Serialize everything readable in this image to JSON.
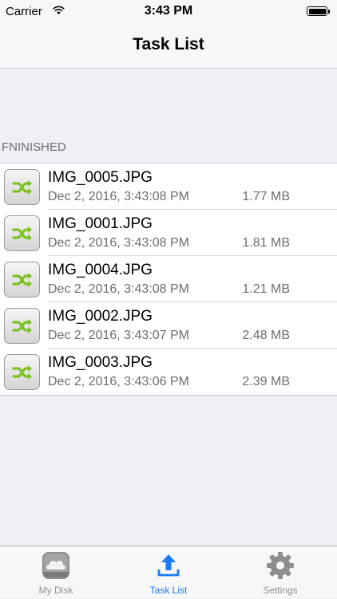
{
  "status_bar": {
    "carrier": "Carrier",
    "time": "3:43 PM",
    "wifi_icon": "wifi-icon",
    "battery_icon": "battery-icon"
  },
  "nav": {
    "title": "Task List"
  },
  "section": {
    "header": "FNINISHED"
  },
  "tasks": [
    {
      "name": "IMG_0005.JPG",
      "date": "Dec 2, 2016, 3:43:08 PM",
      "size": "1.77 MB",
      "icon": "shuffle-icon"
    },
    {
      "name": "IMG_0001.JPG",
      "date": "Dec 2, 2016, 3:43:08 PM",
      "size": "1.81 MB",
      "icon": "shuffle-icon"
    },
    {
      "name": "IMG_0004.JPG",
      "date": "Dec 2, 2016, 3:43:08 PM",
      "size": "1.21 MB",
      "icon": "shuffle-icon"
    },
    {
      "name": "IMG_0002.JPG",
      "date": "Dec 2, 2016, 3:43:07 PM",
      "size": "2.48 MB",
      "icon": "shuffle-icon"
    },
    {
      "name": "IMG_0003.JPG",
      "date": "Dec 2, 2016, 3:43:06 PM",
      "size": "2.39 MB",
      "icon": "shuffle-icon"
    }
  ],
  "tab_bar": {
    "active_index": 1,
    "active_color": "#1a7cf2",
    "inactive_color": "#929292",
    "tabs": [
      {
        "label": "My Disk",
        "icon": "cloud-disk-icon"
      },
      {
        "label": "Task List",
        "icon": "upload-icon"
      },
      {
        "label": "Settings",
        "icon": "gear-icon"
      }
    ]
  }
}
